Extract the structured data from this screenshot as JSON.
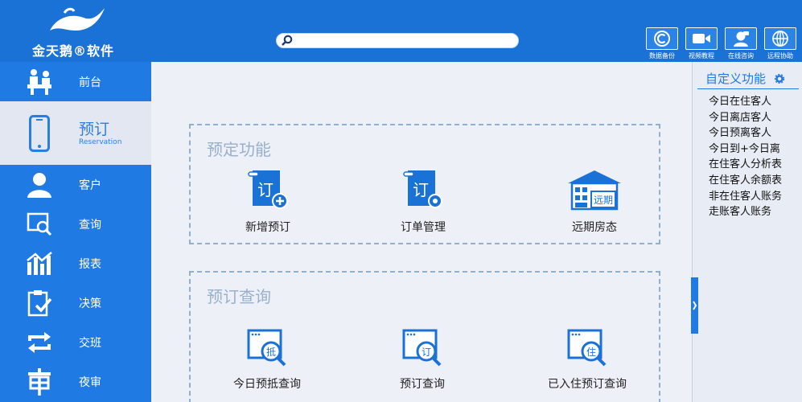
{
  "header": {
    "logo_text": "金天鹅®软件",
    "tools": [
      {
        "label": "数据备份",
        "icon": "backup-c-icon"
      },
      {
        "label": "视频教程",
        "icon": "video-camera-icon"
      },
      {
        "label": "在线咨询",
        "icon": "chat-person-icon"
      },
      {
        "label": "远程协助",
        "icon": "globe-icon"
      }
    ]
  },
  "sidebar": {
    "items": [
      {
        "label": "前台",
        "icon": "front-desk-icon"
      },
      {
        "label": "预订",
        "sub": "Reservation",
        "icon": "phone-icon"
      },
      {
        "label": "客户",
        "icon": "person-icon"
      },
      {
        "label": "查询",
        "icon": "search-window-icon"
      },
      {
        "label": "报表",
        "icon": "bar-chart-icon"
      },
      {
        "label": "决策",
        "icon": "clipboard-check-icon"
      },
      {
        "label": "交班",
        "icon": "exchange-icon"
      },
      {
        "label": "夜审",
        "icon": "audit-icon"
      }
    ]
  },
  "main": {
    "sections": [
      {
        "title": "预定功能",
        "items": [
          {
            "label": "新增预订",
            "icon": "new-order-icon",
            "glyph": "订"
          },
          {
            "label": "订单管理",
            "icon": "order-manage-icon",
            "glyph": "订"
          },
          {
            "label": "远期房态",
            "icon": "future-room-icon",
            "glyph": "远期"
          }
        ]
      },
      {
        "title": "预订查询",
        "items": [
          {
            "label": "今日预抵查询",
            "icon": "arrival-search-icon",
            "glyph": "抵"
          },
          {
            "label": "预订查询",
            "icon": "order-search-icon",
            "glyph": "订"
          },
          {
            "label": "已入住预订查询",
            "icon": "checkin-search-icon",
            "glyph": "住"
          }
        ]
      }
    ]
  },
  "rpanel": {
    "title": "自定义功能",
    "items": [
      "今日在住客人",
      "今日离店客人",
      "今日预离客人",
      "今日到+今日离",
      "在住客人分析表",
      "在住客人余额表",
      "非在住客人账务",
      "走账客人账务"
    ]
  },
  "colors": {
    "primary": "#1a72d6",
    "sidebar": "#1f7ae3",
    "active_bg": "#e3e7f1",
    "section_title": "#98b0cc"
  }
}
